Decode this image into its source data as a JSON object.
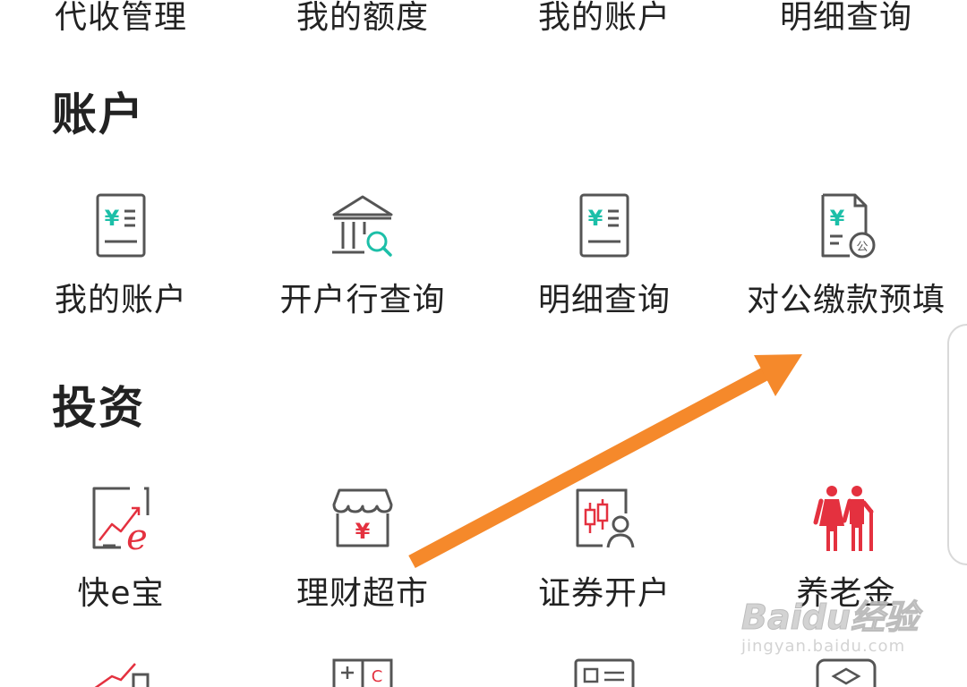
{
  "top_row": [
    {
      "label": "代收管理"
    },
    {
      "label": "我的额度"
    },
    {
      "label": "我的账户"
    },
    {
      "label": "明细查询"
    }
  ],
  "sections": {
    "account": {
      "title": "账户",
      "items": [
        {
          "label": "我的账户",
          "icon": "bill-document-icon"
        },
        {
          "label": "开户行查询",
          "icon": "bank-search-icon"
        },
        {
          "label": "明细查询",
          "icon": "bill-document-icon"
        },
        {
          "label": "对公缴款预填",
          "icon": "public-payment-document-icon"
        }
      ]
    },
    "investment": {
      "title": "投资",
      "items": [
        {
          "label": "快e宝",
          "icon": "trend-chart-e-icon"
        },
        {
          "label": "理财超市",
          "icon": "shop-yuan-icon"
        },
        {
          "label": "证券开户",
          "icon": "stock-account-icon"
        },
        {
          "label": "养老金",
          "icon": "elderly-couple-icon"
        }
      ]
    }
  },
  "colors": {
    "account_accent": "#1cbfa8",
    "investment_accent": "#e4313f",
    "icon_stroke": "#555555",
    "arrow": "#f5892b"
  },
  "watermark": {
    "logo": "Baidu经验",
    "url": "jingyan.baidu.com"
  }
}
